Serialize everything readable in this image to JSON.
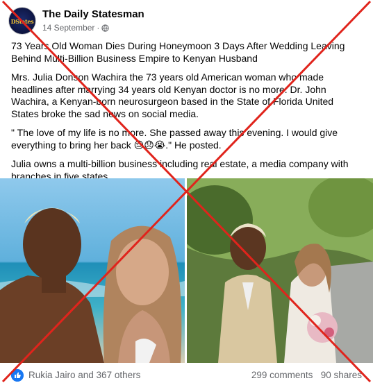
{
  "post": {
    "page_name": "The Daily Statesman",
    "avatar_text": "DStates",
    "date": "14 September",
    "separator": "·",
    "audience_icon": "globe-icon",
    "headline": "73 Years Old Woman Dies During Honeymoon 3 Days After Wedding Leaving Behind Multi-Billion Business Empire to Kenyan Husband",
    "paragraph_1": "Mrs. Julia Donson Wachira the 73 years old American woman who made headlines after marrying 34 years old Kenyan doctor is no more. Dr. John Wachira, a Kenyan-born neurosurgeon based in the State of Florida United States broke the sad news on social media.",
    "quote": "\" The love of my life is no more. She passed away this evening. I would give everything to bring her back 😔😞😭.\" He posted.",
    "paragraph_3": "Julia owns a multi-billion business including real estate, a media company with branches in five states."
  },
  "photos": {
    "left_alt_icon": "beach-selfie-photo",
    "right_alt_icon": "wedding-photo"
  },
  "footer": {
    "like_icon": "thumbs-up-icon",
    "reactions_text": "Rukia Jairo and 367 others",
    "comments": "299 comments",
    "shares": "90 shares"
  },
  "overlay": {
    "type": "red-x-cross",
    "color": "#e0241c"
  }
}
